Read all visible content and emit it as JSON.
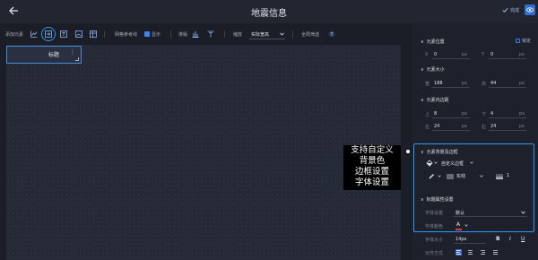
{
  "header": {
    "title": "地震信息",
    "done_label": "完成"
  },
  "toolbar": {
    "add_element_label": "添加元素",
    "gridline_label": "网格参考线",
    "show_label": "显示",
    "snap_label": "排版",
    "zoom_label": "缩放",
    "zoom_value": "实际宽高",
    "global_filter_label": "全局筛选"
  },
  "canvas": {
    "element_title": "标题",
    "element_menu": "⋮"
  },
  "annotation": {
    "lines": [
      "支持自定义",
      "背景色",
      "边框设置",
      "字体设置"
    ]
  },
  "panel": {
    "position": {
      "title": "元素位置",
      "lock_label": "锁定",
      "x_label": "X",
      "x_value": "0",
      "x_unit": "px",
      "y_label": "Y",
      "y_value": "0",
      "y_unit": "px"
    },
    "size": {
      "title": "元素大小",
      "w_label": "宽",
      "w_value": "188",
      "w_unit": "px",
      "h_label": "高",
      "h_value": "44",
      "h_unit": "px"
    },
    "padding": {
      "title": "元素内边距",
      "top_label": "上",
      "top_value": "8",
      "top_unit": "px",
      "bottom_label": "下",
      "bottom_value": "4",
      "bottom_unit": "px",
      "left_label": "左",
      "left_value": "24",
      "left_unit": "px",
      "right_label": "右",
      "right_value": "24",
      "right_unit": "px"
    },
    "background_border": {
      "title": "元素背景及边框",
      "bg_select_value": "自定义边框",
      "border_style_value": "实线",
      "border_width_value": "1"
    },
    "title_props": {
      "title": "标题属性设置",
      "font_setting_label": "字体设置",
      "font_setting_value": "默认",
      "font_color_label": "字体颜色",
      "font_color_glyph": "A",
      "font_size_label": "字体大小",
      "font_size_value": "14px",
      "bold": "B",
      "italic": "I",
      "underline": "U",
      "align_label": "对齐方式"
    }
  },
  "colors": {
    "accent": "#2d9bf0",
    "primary": "#3b82f6",
    "font_color_swatch": "#e53935"
  }
}
